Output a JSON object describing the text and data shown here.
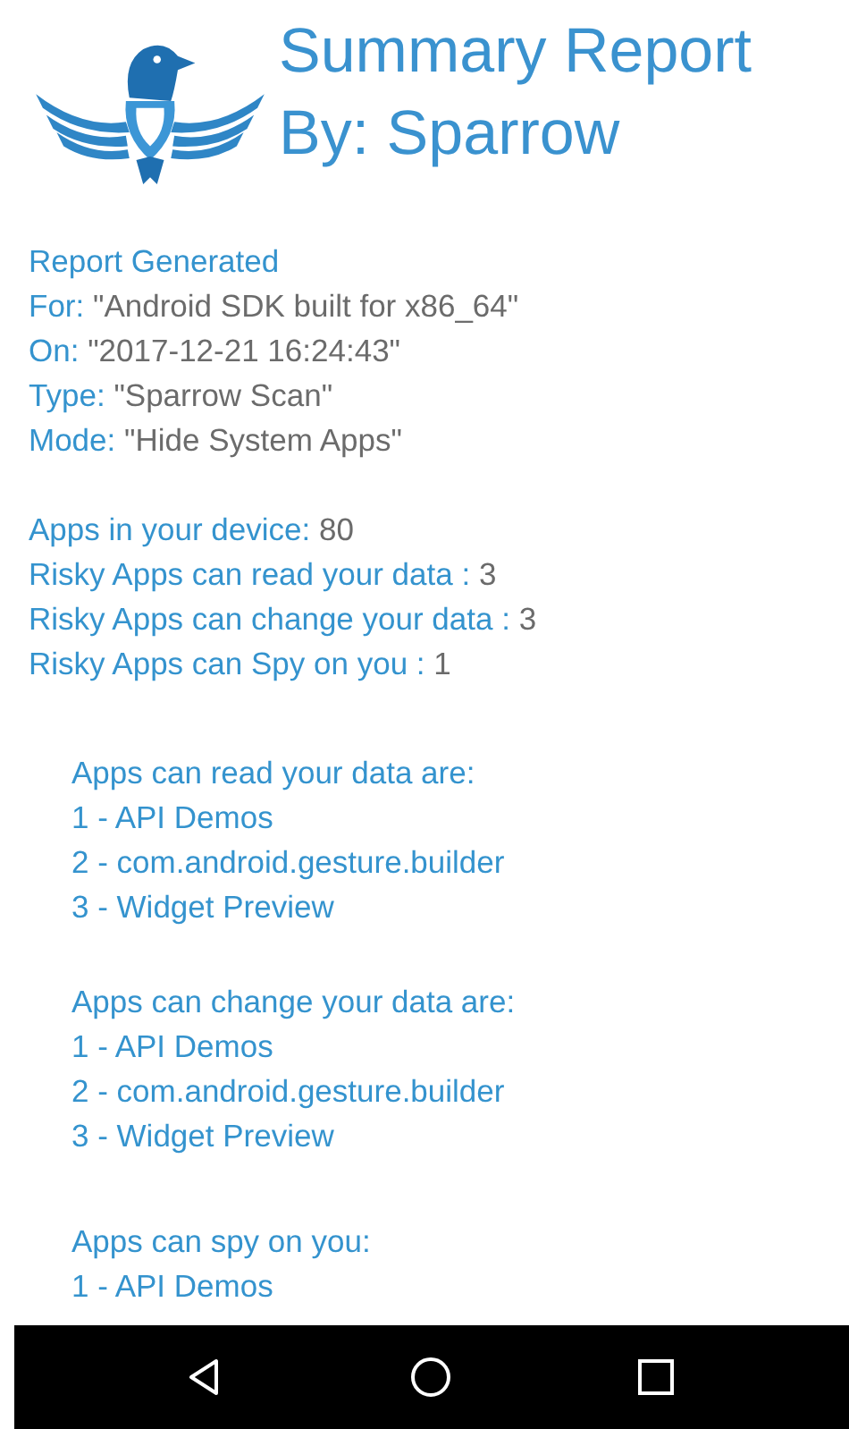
{
  "header": {
    "title_lines": [
      "Summary Report",
      "By: Sparrow"
    ]
  },
  "report_info": [
    {
      "label": "Report Generated"
    },
    {
      "label": "For:",
      "value": "\"Android SDK built for x86_64\""
    },
    {
      "label": "On:",
      "value": "\"2017-12-21 16:24:43\""
    },
    {
      "label": "Type:",
      "value": "\"Sparrow Scan\""
    },
    {
      "label": "Mode:",
      "value": "\"Hide System Apps\""
    }
  ],
  "stats": [
    {
      "label": "Apps in your device:",
      "value": "80"
    },
    {
      "label": "Risky Apps can read your data :",
      "value": "3"
    },
    {
      "label": "Risky Apps can change your data :",
      "value": "3"
    },
    {
      "label": "Risky Apps can Spy on you :",
      "value": "1"
    }
  ],
  "app_lists": [
    {
      "heading": "Apps can read your data are:",
      "items": [
        "1 - API Demos",
        "2 - com.android.gesture.builder",
        "3 - Widget Preview"
      ]
    },
    {
      "heading": "Apps can change your data are:",
      "items": [
        "1 - API Demos",
        "2 - com.android.gesture.builder",
        "3 - Widget Preview"
      ]
    },
    {
      "heading": "Apps can spy on you:",
      "items": [
        "1 - API Demos"
      ]
    }
  ],
  "nav_bar": {
    "buttons": [
      {
        "kind": "back"
      },
      {
        "kind": "home"
      },
      {
        "kind": "recents"
      }
    ]
  }
}
